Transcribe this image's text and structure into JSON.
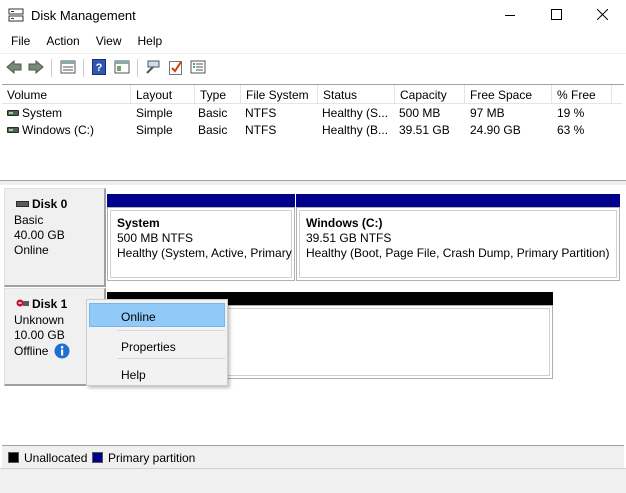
{
  "window": {
    "title": "Disk Management"
  },
  "menu": {
    "items": [
      "File",
      "Action",
      "View",
      "Help"
    ]
  },
  "toolbar": {
    "icons": [
      "back-icon",
      "forward-icon",
      "show-list-icon",
      "help-icon",
      "properties-icon",
      "connect-icon",
      "check-icon",
      "settings-icon"
    ]
  },
  "volumes": {
    "columns": [
      "Volume",
      "Layout",
      "Type",
      "File System",
      "Status",
      "Capacity",
      "Free Space",
      "% Free"
    ],
    "rows": [
      {
        "volume": "System",
        "layout": "Simple",
        "type": "Basic",
        "fs": "NTFS",
        "status": "Healthy (S...",
        "capacity": "500 MB",
        "free": "97 MB",
        "pct": "19 %"
      },
      {
        "volume": "Windows (C:)",
        "layout": "Simple",
        "type": "Basic",
        "fs": "NTFS",
        "status": "Healthy (B...",
        "capacity": "39.51 GB",
        "free": "24.90 GB",
        "pct": "63 %"
      }
    ]
  },
  "disks": [
    {
      "name": "Disk 0",
      "type": "Basic",
      "size": "40.00 GB",
      "state": "Online",
      "partitions": [
        {
          "title": "System",
          "size": "500 MB NTFS",
          "status": "Healthy (System, Active, Primary"
        },
        {
          "title": "Windows  (C:)",
          "size": "39.51 GB NTFS",
          "status": "Healthy (Boot, Page File, Crash Dump, Primary Partition)"
        }
      ]
    },
    {
      "name": "Disk 1",
      "type": "Unknown",
      "size": "10.00 GB",
      "state": "Offline"
    }
  ],
  "context_menu": {
    "items": [
      "Online",
      "Properties",
      "Help"
    ],
    "highlighted": "Online"
  },
  "legend": {
    "items": [
      {
        "label": "Unallocated",
        "color": "#000000"
      },
      {
        "label": "Primary partition",
        "color": "#00008b"
      }
    ]
  },
  "colors": {
    "primary_partition": "#00008b",
    "unallocated": "#000000",
    "menu_highlight": "#91c9f7",
    "info": "#1e6fd0",
    "offline_badge": "#c8102e"
  }
}
